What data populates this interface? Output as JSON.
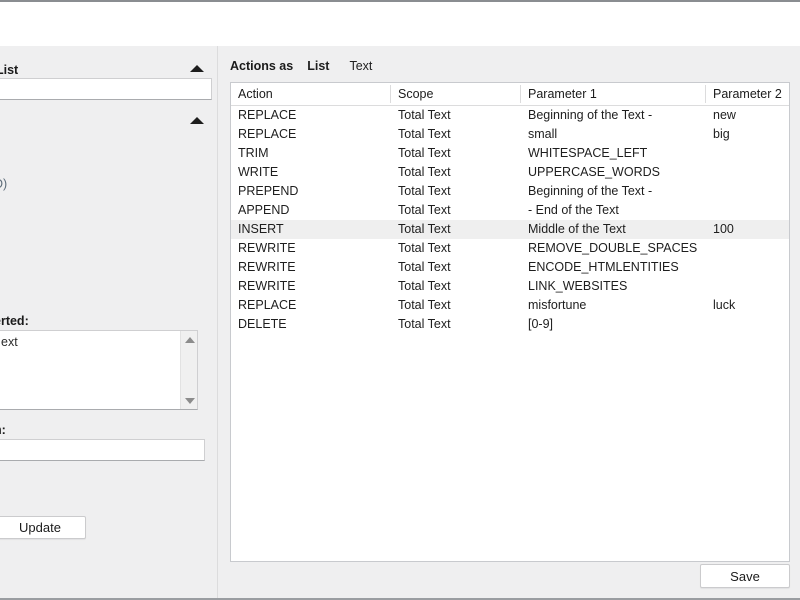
{
  "left_panel": {
    "section1_title": "List",
    "section1_collapse_icon": "chevron-up-icon",
    "section2_collapse_icon": "chevron-up-icon",
    "fragments": [
      ")",
      "D)",
      ")",
      ")"
    ],
    "inserted_label": "erted:",
    "textarea_value": "ext",
    "bottom_label": "n:",
    "bottom_input_value": "",
    "update_button": "Update",
    "scroll_up_icon": "triangle-up-icon",
    "scroll_down_icon": "triangle-down-icon"
  },
  "right_panel": {
    "tabbar": {
      "title": "Actions as",
      "tabs": [
        {
          "label": "List",
          "active": true
        },
        {
          "label": "Text",
          "active": false
        }
      ]
    },
    "table": {
      "columns": [
        "Action",
        "Scope",
        "Parameter 1",
        "Parameter 2"
      ],
      "rows": [
        {
          "action": "REPLACE",
          "scope": "Total Text",
          "p1": "Beginning of the Text -",
          "p2": "new",
          "selected": false
        },
        {
          "action": "REPLACE",
          "scope": "Total Text",
          "p1": "small",
          "p2": "big",
          "selected": false
        },
        {
          "action": "TRIM",
          "scope": "Total Text",
          "p1": "WHITESPACE_LEFT",
          "p2": "",
          "selected": false
        },
        {
          "action": "WRITE",
          "scope": "Total Text",
          "p1": "UPPERCASE_WORDS",
          "p2": "",
          "selected": false
        },
        {
          "action": "PREPEND",
          "scope": "Total Text",
          "p1": "Beginning of the Text -",
          "p2": "",
          "selected": false
        },
        {
          "action": "APPEND",
          "scope": "Total Text",
          "p1": "- End of the Text",
          "p2": "",
          "selected": false
        },
        {
          "action": "INSERT",
          "scope": "Total Text",
          "p1": "Middle of the Text",
          "p2": "100",
          "selected": true
        },
        {
          "action": "REWRITE",
          "scope": "Total Text",
          "p1": "REMOVE_DOUBLE_SPACES",
          "p2": "",
          "selected": false
        },
        {
          "action": "REWRITE",
          "scope": "Total Text",
          "p1": "ENCODE_HTMLENTITIES",
          "p2": "",
          "selected": false
        },
        {
          "action": "REWRITE",
          "scope": "Total Text",
          "p1": "LINK_WEBSITES",
          "p2": "",
          "selected": false
        },
        {
          "action": "REPLACE",
          "scope": "Total Text",
          "p1": "misfortune",
          "p2": "luck",
          "selected": false
        },
        {
          "action": "DELETE",
          "scope": "Total Text",
          "p1": "[0-9]",
          "p2": "",
          "selected": false
        }
      ]
    },
    "save_button": "Save"
  },
  "colors": {
    "window_bg": "#efeff0",
    "panel_white": "#ffffff",
    "selected_row": "#efefef",
    "border": "#c8cace",
    "text": "#1b1b1b"
  }
}
